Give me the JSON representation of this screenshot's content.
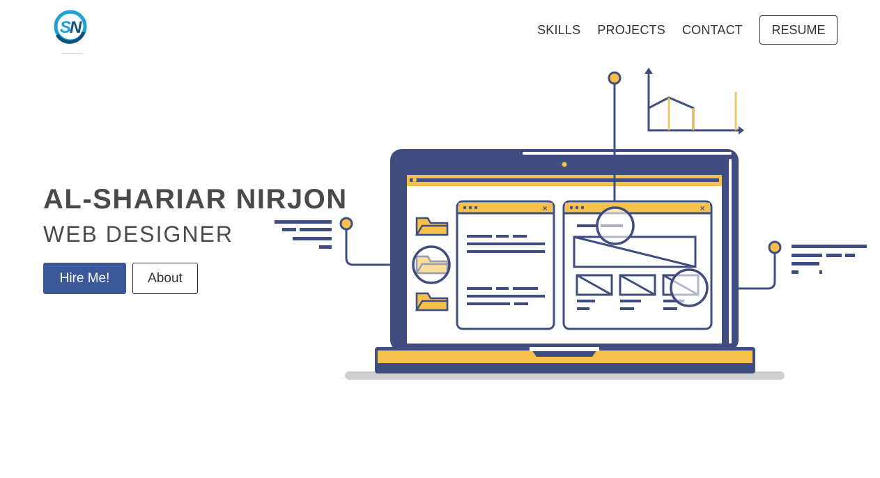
{
  "header": {
    "logo_icon": "sn-logo-icon",
    "nav": {
      "skills_label": "SKILLS",
      "projects_label": "PROJECTS",
      "contact_label": "CONTACT",
      "resume_label": "RESUME"
    }
  },
  "hero": {
    "name": "AL-SHARIAR NIRJON",
    "role": "WEB DESIGNER",
    "hire_label": "Hire Me!",
    "about_label": "About"
  },
  "colors": {
    "primary": "#3b5998",
    "navy": "#3f4d80",
    "yellow": "#f7c04a",
    "text": "#4a4a4a",
    "shadow": "#d3d3d3"
  },
  "icons": {
    "illustration": "laptop-web-design-illustration",
    "folder": "folder-icon",
    "chart": "line-chart-icon"
  }
}
